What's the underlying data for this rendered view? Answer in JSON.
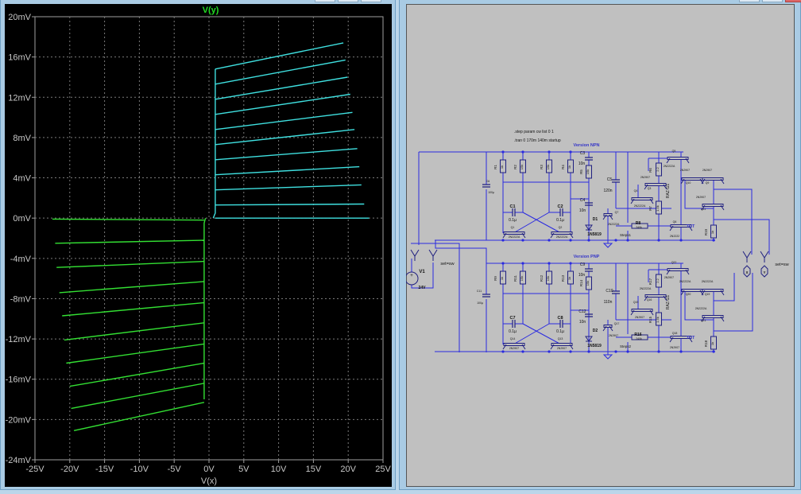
{
  "colors": {
    "plot_bg": "#000000",
    "grid": "#7a7a7a",
    "axis_text": "#c8c8c8",
    "npn_trace": "#3fe0e0",
    "pnp_trace": "#33e033",
    "title": "#22dd22",
    "schematic_bg": "#c0c0c0",
    "wire": "#2a2ae0",
    "label_blue": "#3535c8"
  },
  "chart_data": {
    "type": "line",
    "title": "V(y)",
    "xlabel": "V(x)",
    "ylabel": "",
    "xlim": [
      -25,
      25
    ],
    "ylim": [
      -24,
      20
    ],
    "grid": true,
    "x_ticks": [
      "-25V",
      "-20V",
      "-15V",
      "-10V",
      "-5V",
      "0V",
      "5V",
      "10V",
      "15V",
      "20V",
      "25V"
    ],
    "x_tick_values": [
      -25,
      -20,
      -15,
      -10,
      -5,
      0,
      5,
      10,
      15,
      20,
      25
    ],
    "y_ticks": [
      "20mV",
      "16mV",
      "12mV",
      "8mV",
      "4mV",
      "0mV",
      "-4mV",
      "-8mV",
      "-12mV",
      "-16mV",
      "-20mV",
      "-24mV"
    ],
    "y_tick_values": [
      20,
      16,
      12,
      8,
      4,
      0,
      -4,
      -8,
      -12,
      -16,
      -20,
      -24
    ],
    "x_unit": "V",
    "y_unit": "mV",
    "series": [
      {
        "color": "#3fe0e0",
        "points": [
          [
            0.6,
            0
          ],
          [
            0.9,
            0.5
          ],
          [
            0.9,
            14.8
          ]
        ]
      },
      {
        "color": "#3fe0e0",
        "points": [
          [
            0.9,
            0
          ],
          [
            23.0,
            0
          ]
        ]
      },
      {
        "color": "#3fe0e0",
        "points": [
          [
            0.9,
            1.3
          ],
          [
            22.3,
            1.4
          ]
        ]
      },
      {
        "color": "#3fe0e0",
        "points": [
          [
            0.9,
            2.8
          ],
          [
            21.9,
            3.3
          ]
        ]
      },
      {
        "color": "#3fe0e0",
        "points": [
          [
            0.9,
            4.3
          ],
          [
            21.6,
            5.1
          ]
        ]
      },
      {
        "color": "#3fe0e0",
        "points": [
          [
            0.9,
            5.8
          ],
          [
            21.3,
            6.9
          ]
        ]
      },
      {
        "color": "#3fe0e0",
        "points": [
          [
            0.9,
            7.3
          ],
          [
            20.9,
            8.8
          ]
        ]
      },
      {
        "color": "#3fe0e0",
        "points": [
          [
            0.9,
            8.8
          ],
          [
            20.6,
            10.5
          ]
        ]
      },
      {
        "color": "#3fe0e0",
        "points": [
          [
            0.9,
            10.3
          ],
          [
            20.3,
            12.3
          ]
        ]
      },
      {
        "color": "#3fe0e0",
        "points": [
          [
            0.9,
            11.8
          ],
          [
            19.9,
            14.0
          ]
        ]
      },
      {
        "color": "#3fe0e0",
        "points": [
          [
            0.9,
            13.3
          ],
          [
            19.6,
            15.7
          ]
        ]
      },
      {
        "color": "#3fe0e0",
        "points": [
          [
            0.9,
            14.8
          ],
          [
            19.3,
            17.4
          ]
        ]
      },
      {
        "color": "#33e033",
        "points": [
          [
            -0.5,
            0
          ],
          [
            -0.7,
            -0.5
          ],
          [
            -0.7,
            -18.0
          ]
        ]
      },
      {
        "color": "#33e033",
        "points": [
          [
            -22.5,
            -0.1
          ],
          [
            -0.7,
            -0.2
          ]
        ]
      },
      {
        "color": "#33e033",
        "points": [
          [
            -22.1,
            -2.5
          ],
          [
            -0.7,
            -2.2
          ]
        ]
      },
      {
        "color": "#33e033",
        "points": [
          [
            -21.9,
            -4.9
          ],
          [
            -0.7,
            -4.3
          ]
        ]
      },
      {
        "color": "#33e033",
        "points": [
          [
            -21.5,
            -7.4
          ],
          [
            -0.7,
            -6.3
          ]
        ]
      },
      {
        "color": "#33e033",
        "points": [
          [
            -21.1,
            -9.7
          ],
          [
            -0.7,
            -8.4
          ]
        ]
      },
      {
        "color": "#33e033",
        "points": [
          [
            -20.8,
            -12.1
          ],
          [
            -0.7,
            -10.4
          ]
        ]
      },
      {
        "color": "#33e033",
        "points": [
          [
            -20.5,
            -14.4
          ],
          [
            -0.7,
            -12.5
          ]
        ]
      },
      {
        "color": "#33e033",
        "points": [
          [
            -20.0,
            -16.7
          ],
          [
            -0.7,
            -14.4
          ]
        ]
      },
      {
        "color": "#33e033",
        "points": [
          [
            -19.8,
            -18.9
          ],
          [
            -0.7,
            -16.4
          ]
        ]
      },
      {
        "color": "#33e033",
        "points": [
          [
            -19.4,
            -21.1
          ],
          [
            -0.7,
            -18.3
          ]
        ]
      }
    ]
  },
  "schematic": {
    "directives": [
      ".step param cw list 0 1",
      ".tran 0 170m 140m startup"
    ],
    "globals": {
      "v1_name": "V1",
      "v1_value": "24V",
      "left_switch_param": "set=sw",
      "c6_name": "C6",
      "c6_value": "100µ",
      "c11_name": "C11",
      "c11_value": "100µ",
      "x_label": "X",
      "y_label": "Y",
      "right_switch_param": "set=sw"
    },
    "npn": [
      "Version NPN",
      "R1",
      "1k",
      "R2",
      "15k",
      "R3",
      "15k",
      "R4",
      "1k",
      "C3",
      "10n",
      "R5",
      "15k",
      "C5",
      "120n",
      "C4",
      "10n",
      "C1",
      "0.1µ",
      "C2",
      "0.1µ",
      "Q1",
      "2N2222A",
      "Q2",
      "2N2222A",
      "D1",
      "1N5819",
      "Q7",
      "2N2222A",
      "R8",
      "240k",
      "Steps1",
      "Q5",
      "2N2222A",
      "R6",
      "2.2",
      "2N2907",
      "Q3",
      "Q4",
      "RAZ-G1",
      "2N2222A",
      "R7",
      "1.5k",
      "Q6",
      "TUT",
      "2N2222",
      "2N2907",
      "Q10",
      "2N2907",
      "Q9",
      "2N2907",
      "Q11",
      "R10",
      "1k"
    ],
    "pnp": [
      "Version PNP",
      "R9",
      "1k",
      "R11",
      "15k",
      "R12",
      "15k",
      "R13",
      "1k",
      "C9",
      "10n",
      "R14",
      "15k",
      "C10",
      "110n",
      "C12",
      "10n",
      "C7",
      "0.1µ",
      "C8",
      "0.1µ",
      "Q14",
      "2N2907",
      "Q13",
      "2N2907",
      "D2",
      "1N5819",
      "Q17",
      "2N2907",
      "R16",
      "240k",
      "Steps2",
      "Q22",
      "2N2907",
      "R17",
      "2.2",
      "2N2222A",
      "Q16",
      "Q15",
      "RAZ-G1",
      "2N2907",
      "R15",
      "1.5k",
      "Q18",
      "TUT",
      "2N2907",
      "2N2222A",
      "Q20",
      "2N2222A",
      "Q19",
      "2N2222A",
      "Q21",
      "R18",
      "1k"
    ]
  }
}
